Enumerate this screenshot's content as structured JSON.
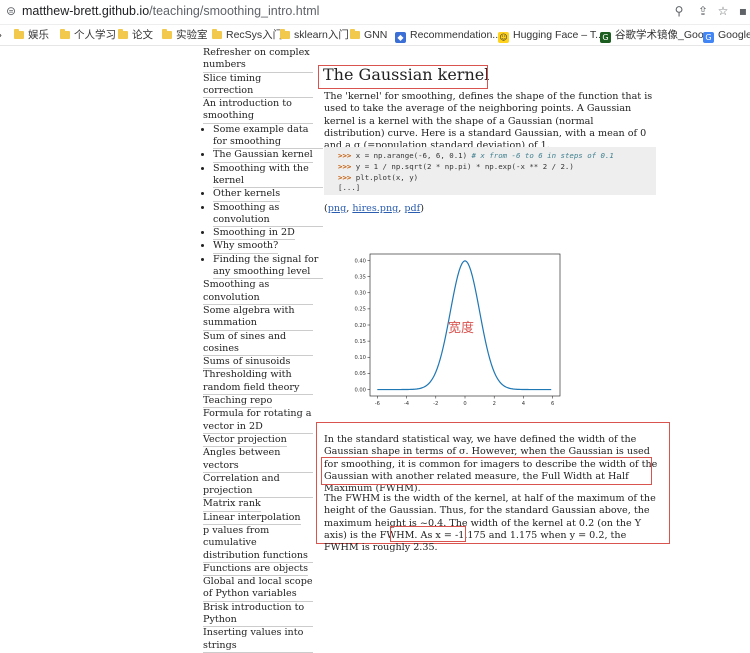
{
  "browser": {
    "url_host": "matthew-brett.github.io",
    "url_path": "/teaching/smoothing_intro.html",
    "bookmarks": [
      {
        "label": "娱乐",
        "icon": "folder"
      },
      {
        "label": "个人学习",
        "icon": "folder"
      },
      {
        "label": "论文",
        "icon": "folder"
      },
      {
        "label": "实验室",
        "icon": "folder"
      },
      {
        "label": "RecSys入门",
        "icon": "folder"
      },
      {
        "label": "sklearn入门",
        "icon": "folder"
      },
      {
        "label": "GNN",
        "icon": "folder"
      },
      {
        "label": "Recommendation...",
        "icon": "app"
      },
      {
        "label": "Hugging Face – T...",
        "icon": "hugging-face"
      },
      {
        "label": "谷歌学术镜像_Goo...",
        "icon": "scholar"
      },
      {
        "label": "Google",
        "icon": "google"
      }
    ]
  },
  "sidebar": {
    "items": [
      {
        "label": "Refresher on complex numbers"
      },
      {
        "label": "Slice timing correction"
      },
      {
        "label": "An introduction to smoothing"
      }
    ],
    "subitems": [
      {
        "label": "Some example data for smoothing"
      },
      {
        "label": "The Gaussian kernel"
      },
      {
        "label": "Smoothing with the kernel"
      },
      {
        "label": "Other kernels"
      },
      {
        "label": "Smoothing as convolution"
      },
      {
        "label": "Smoothing in 2D"
      },
      {
        "label": "Why smooth?"
      },
      {
        "label": "Finding the signal for any smoothing level"
      }
    ],
    "items_after": [
      {
        "label": "Smoothing as convolution"
      },
      {
        "label": "Some algebra with summation"
      },
      {
        "label": "Sum of sines and cosines"
      },
      {
        "label": "Sums of sinusoids"
      },
      {
        "label": "Thresholding with random field theory"
      },
      {
        "label": "Teaching repo"
      },
      {
        "label": "Formula for rotating a vector in 2D"
      },
      {
        "label": "Vector projection"
      },
      {
        "label": "Angles between vectors"
      },
      {
        "label": "Correlation and projection"
      },
      {
        "label": "Matrix rank"
      },
      {
        "label": "Linear interpolation"
      },
      {
        "label": "p values from cumulative distribution functions"
      },
      {
        "label": "Functions are objects"
      },
      {
        "label": "Global and local scope of Python variables"
      },
      {
        "label": "Brisk introduction to Python"
      },
      {
        "label": "Inserting values into strings"
      }
    ]
  },
  "main": {
    "heading": "The Gaussian kernel",
    "intro": "The 'kernel' for smoothing, defines the shape of the function that is used to take the average of the neighboring points. A Gaussian kernel is a kernel with the shape of a Gaussian (normal distribution) curve. Here is a standard Gaussian, with a mean of 0 and a σ (=population standard deviation) of 1.",
    "code": {
      "prompt": ">>>",
      "line1": " x = np.arange(-6, 6, 0.1) ",
      "line1_comment": "# x from -6 to 6 in steps of 0.1",
      "line2": " y = 1 / np.sqrt(2 * np.pi) * np.exp(-x ** 2 / 2.)",
      "line3": " plt.plot(x, y)",
      "line4": "[...]"
    },
    "links": {
      "open": "(",
      "png": "png",
      "sep1": ", ",
      "hires": "hires.png",
      "sep2": ", ",
      "pdf": "pdf",
      "close": ")"
    },
    "annotation": "宽度",
    "para2": "In the standard statistical way, we have defined the width of the Gaussian shape in terms of σ. However, when the Gaussian is used for smoothing, it is common for imagers to describe the width of the Gaussian with another related measure, the Full Width at Half Maximum (FWHM).",
    "para3": "The FWHM is the width of the kernel, at half of the maximum of the height of the Gaussian. Thus, for the standard Gaussian above, the maximum height is ~0.4. The width of the kernel at 0.2 (on the Y axis) is the FWHM. As x = -1.175 and 1.175 when y = 0.2, the FWHM is roughly 2.35."
  },
  "chart_data": {
    "type": "line",
    "series": [
      {
        "function": "y = 1/sqrt(2*pi) * exp(-x^2/2)",
        "x_range": [
          -6,
          6
        ],
        "step": 0.1
      }
    ],
    "xlim": [
      -6.5,
      6.5
    ],
    "ylim": [
      -0.02,
      0.42
    ],
    "xticks": [
      -6,
      -4,
      -2,
      0,
      2,
      4,
      6
    ],
    "yticks": [
      0.0,
      0.05,
      0.1,
      0.15,
      0.2,
      0.25,
      0.3,
      0.35,
      0.4
    ],
    "ytick_labels": [
      "0.00",
      "0.05",
      "0.10",
      "0.15",
      "0.20",
      "0.25",
      "0.30",
      "0.35",
      "0.40"
    ],
    "line_color": "#1f77b4",
    "grid": false
  },
  "colors": {
    "highlight": "#d9534f",
    "link": "#2a5db0"
  }
}
